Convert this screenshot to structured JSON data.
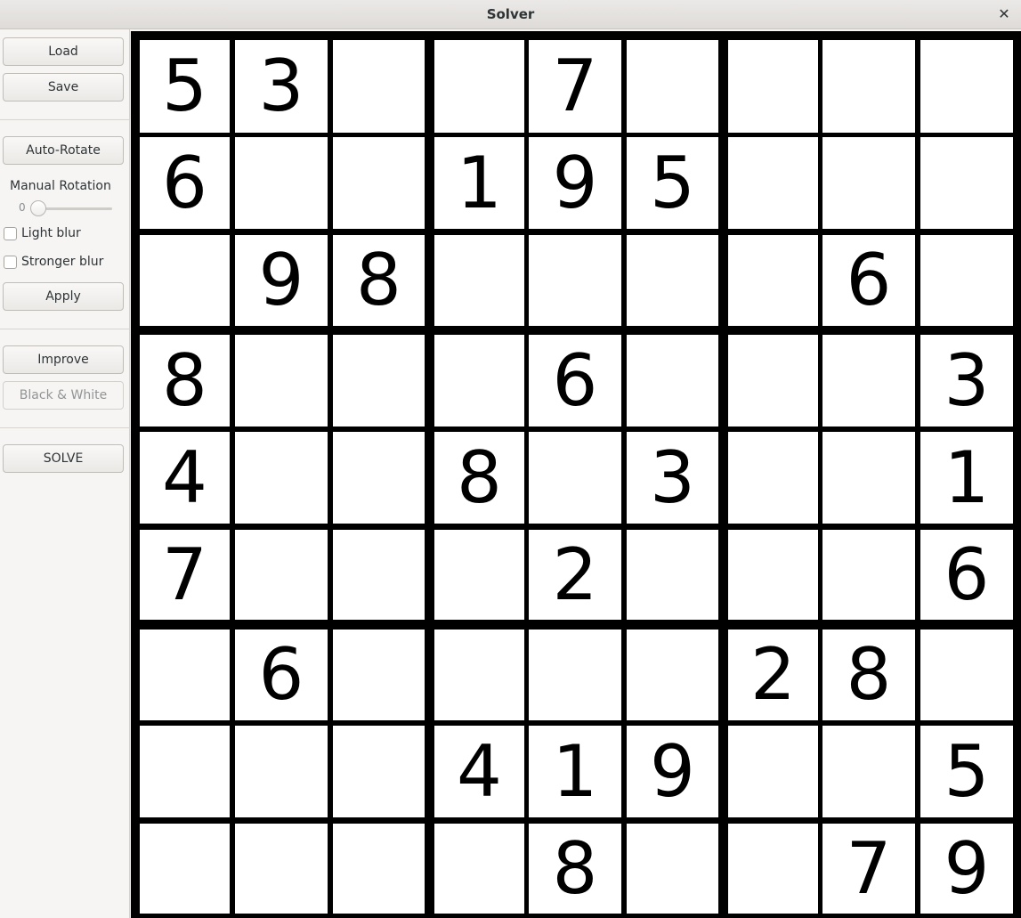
{
  "window": {
    "title": "Solver",
    "close_glyph": "✕"
  },
  "sidebar": {
    "load_label": "Load",
    "save_label": "Save",
    "auto_rotate_label": "Auto-Rotate",
    "manual_rotation_label": "Manual Rotation",
    "rotation_value": "0",
    "light_blur_label": "Light blur",
    "stronger_blur_label": "Stronger blur",
    "apply_label": "Apply",
    "improve_label": "Improve",
    "black_white_label": "Black & White",
    "solve_label": "SOLVE"
  },
  "board": {
    "rows": [
      [
        "5",
        "3",
        "",
        "",
        "7",
        "",
        "",
        "",
        ""
      ],
      [
        "6",
        "",
        "",
        "1",
        "9",
        "5",
        "",
        "",
        ""
      ],
      [
        "",
        "9",
        "8",
        "",
        "",
        "",
        "",
        "6",
        ""
      ],
      [
        "8",
        "",
        "",
        "",
        "6",
        "",
        "",
        "",
        "3"
      ],
      [
        "4",
        "",
        "",
        "8",
        "",
        "3",
        "",
        "",
        "1"
      ],
      [
        "7",
        "",
        "",
        "",
        "2",
        "",
        "",
        "",
        "6"
      ],
      [
        "",
        "6",
        "",
        "",
        "",
        "",
        "2",
        "8",
        ""
      ],
      [
        "",
        "",
        "",
        "4",
        "1",
        "9",
        "",
        "",
        "5"
      ],
      [
        "",
        "",
        "",
        "",
        "8",
        "",
        "",
        "7",
        "9"
      ]
    ]
  },
  "icons": {
    "close": "close-icon"
  }
}
